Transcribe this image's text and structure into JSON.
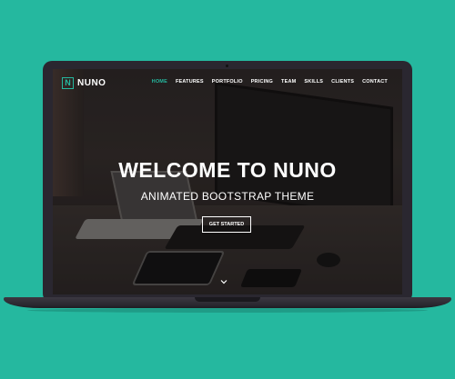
{
  "brand": {
    "logo_letter": "N",
    "name": "NUNO"
  },
  "nav": {
    "items": [
      {
        "label": "HOME",
        "active": true
      },
      {
        "label": "FEATURES",
        "active": false
      },
      {
        "label": "PORTFOLIO",
        "active": false
      },
      {
        "label": "PRICING",
        "active": false
      },
      {
        "label": "TEAM",
        "active": false
      },
      {
        "label": "SKILLS",
        "active": false
      },
      {
        "label": "CLIENTS",
        "active": false
      },
      {
        "label": "CONTACT",
        "active": false
      }
    ]
  },
  "hero": {
    "title": "WELCOME TO NUNO",
    "subtitle": "ANIMATED BOOTSTRAP THEME",
    "cta_label": "GET STARTED",
    "scroll_icon": "chevron-down-icon"
  },
  "colors": {
    "background": "#25b89f",
    "accent": "#25b89f",
    "laptop": "#2a2730",
    "text": "#ffffff"
  }
}
